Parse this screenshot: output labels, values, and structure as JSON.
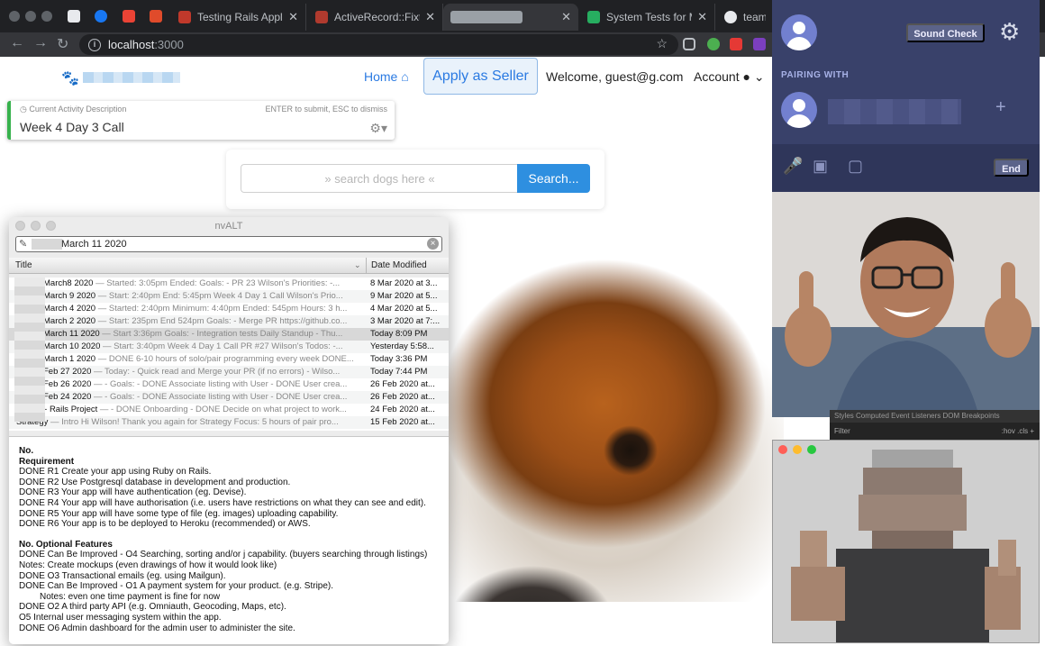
{
  "browser": {
    "tabs": [
      {
        "label": "Testing Rails Applica",
        "icon_color": "#c0392b"
      },
      {
        "label": "ActiveRecord::Fixture",
        "icon_color": "#b03a2e"
      },
      {
        "label": "",
        "icon_color": "#9aa0a6"
      },
      {
        "label": "System Tests for Ma",
        "icon_color": "#27ae60"
      },
      {
        "label": "teamca",
        "icon_color": "#e8eaed"
      }
    ],
    "close_glyph": "✕",
    "url_host": "localhost",
    "url_port": ":3000"
  },
  "site": {
    "nav": {
      "home": "Home",
      "apply_seller": "Apply as Seller",
      "welcome": "Welcome, guest@g.com",
      "account": "Account"
    },
    "search": {
      "placeholder": "» search dogs here «",
      "button": "Search..."
    }
  },
  "activity": {
    "label": "Current Activity Description",
    "hint": "ENTER to submit, ESC to dismiss",
    "value": "Week 4 Day 3 Call"
  },
  "nvalt": {
    "title": "nvALT",
    "query": "March 11 2020",
    "col_title": "Title",
    "col_date": "Date Modified",
    "notes": [
      {
        "title": "March8 2020",
        "preview": " — Started: 3:05pm Ended:   Goals: - PR 23   Wilson's Priorities: -...",
        "date": "8 Mar 2020 at 3..."
      },
      {
        "title": "March 9 2020",
        "preview": " — Start: 2:40pm End:  5:45pm   Week 4 Day 1 Call  Wilson's Prio...",
        "date": "9 Mar 2020 at 5..."
      },
      {
        "title": "March 4 2020",
        "preview": " — Started: 2:40pm Minimum: 4:40pm Ended: 545pm Hours: 3 h...",
        "date": "4 Mar 2020 at 5..."
      },
      {
        "title": "March 2 2020",
        "preview": " — Start: 235pm End 524pm  Goals: - Merge PR https://github.co...",
        "date": "3 Mar 2020 at 7:..."
      },
      {
        "title": "March 11 2020",
        "preview": " — Start 3:36pm  Goals: - Integration tests  Daily Standup - Thu...",
        "date": "Today  8:09 PM"
      },
      {
        "title": "March 10 2020",
        "preview": " — Start: 3:40pm  Week 4 Day 1 Call  PR #27  Wilson's Todos: -...",
        "date": "Yesterday  5:58..."
      },
      {
        "title": "March 1 2020",
        "preview": " — DONE 6-10 hours of solo/pair programming every week DONE...",
        "date": "Today  3:36 PM"
      },
      {
        "title": "Feb 27 2020",
        "preview": " — Today: - Quick read and Merge your PR (if no errors) -     Wilso...",
        "date": "Today  7:44 PM"
      },
      {
        "title": "Feb 26 2020",
        "preview": " — - Goals:  - DONE Associate listing with User  - DONE User crea...",
        "date": "26 Feb 2020 at..."
      },
      {
        "title": "Feb 24 2020",
        "preview": " — - Goals:  - DONE Associate listing with User  - DONE User crea...",
        "date": "26 Feb 2020 at..."
      },
      {
        "title": "Wilson - Rails Project",
        "preview": " — - DONE Onboarding  - DONE Decide on what project to work...",
        "date": "24 Feb 2020 at..."
      },
      {
        "title": "Strategy",
        "preview": " — Intro  Hi Wilson! Thank you again for  Strategy Focus:  5 hours of pair pro...",
        "date": "15 Feb 2020 at..."
      }
    ],
    "body": [
      {
        "text": "No.",
        "style": "b"
      },
      {
        "text": "Requirement",
        "style": "b"
      },
      {
        "text": "DONE  R1 Create your app using Ruby on Rails.",
        "style": ""
      },
      {
        "text": "DONE  R2 Use Postgresql database in development and production.",
        "style": ""
      },
      {
        "text": "DONE  R3 Your app will have authentication (eg. Devise).",
        "style": ""
      },
      {
        "text": "DONE  R4 Your app will have authorisation (i.e. users have restrictions on what they can see and edit).",
        "style": ""
      },
      {
        "text": "DONE R5 Your app will have some type of file (eg. images) uploading capability.",
        "style": ""
      },
      {
        "text": "DONE R6 Your app is to be deployed to Heroku (recommended) or AWS.",
        "style": ""
      },
      {
        "text": "",
        "style": "gap"
      },
      {
        "text": "No. Optional Features",
        "style": "b"
      },
      {
        "text": "DONE Can Be Improved - O4 Searching, sorting and/or j  capability. (buyers searching through listings)",
        "style": ""
      },
      {
        "text": "Notes: Create mockups (even drawings of how it would look like)",
        "style": ""
      },
      {
        "text": "DONE O3 Transactional emails (eg. using Mailgun).",
        "style": ""
      },
      {
        "text": "DONE Can Be Improved -  O1 A payment system for your product. (e.g. Stripe).",
        "style": ""
      },
      {
        "text": "Notes: even one time payment is fine for now",
        "style": "ind"
      },
      {
        "text": "DONE O2 A third party API (e.g. Omniauth, Geocoding, Maps, etc).",
        "style": ""
      },
      {
        "text": "O5 Internal user messaging system within the app.",
        "style": ""
      },
      {
        "text": "DONE O6 Admin dashboard for the admin user to administer the site.",
        "style": ""
      }
    ]
  },
  "pairing": {
    "sound_check": "Sound Check",
    "pairing_with": "PAIRING WITH",
    "end": "End"
  },
  "devtools": {
    "tabs": "Styles    Computed    Event Listeners    DOM Breakpoints",
    "filter": "Filter",
    "hov_cls": ":hov  .cls  +"
  },
  "colors": {
    "accent": "#2a7ae2",
    "search_button": "#2e8fe0",
    "pairing_bg": "#39416a",
    "activity_bar": "#37b24d"
  }
}
